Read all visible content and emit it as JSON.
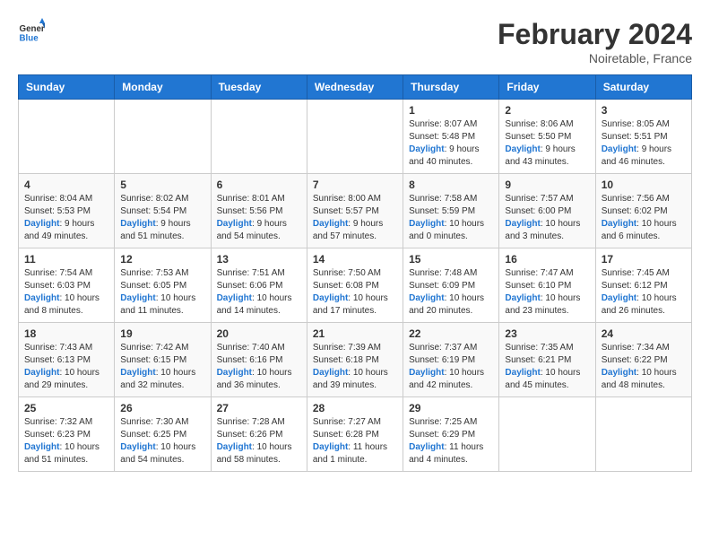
{
  "header": {
    "logo_general": "General",
    "logo_blue": "Blue",
    "month_year": "February 2024",
    "location": "Noiretable, France"
  },
  "weekdays": [
    "Sunday",
    "Monday",
    "Tuesday",
    "Wednesday",
    "Thursday",
    "Friday",
    "Saturday"
  ],
  "weeks": [
    [
      {
        "day": "",
        "sunrise": "",
        "sunset": "",
        "daylight": ""
      },
      {
        "day": "",
        "sunrise": "",
        "sunset": "",
        "daylight": ""
      },
      {
        "day": "",
        "sunrise": "",
        "sunset": "",
        "daylight": ""
      },
      {
        "day": "",
        "sunrise": "",
        "sunset": "",
        "daylight": ""
      },
      {
        "day": "1",
        "sunrise": "Sunrise: 8:07 AM",
        "sunset": "Sunset: 5:48 PM",
        "daylight": "Daylight: 9 hours and 40 minutes."
      },
      {
        "day": "2",
        "sunrise": "Sunrise: 8:06 AM",
        "sunset": "Sunset: 5:50 PM",
        "daylight": "Daylight: 9 hours and 43 minutes."
      },
      {
        "day": "3",
        "sunrise": "Sunrise: 8:05 AM",
        "sunset": "Sunset: 5:51 PM",
        "daylight": "Daylight: 9 hours and 46 minutes."
      }
    ],
    [
      {
        "day": "4",
        "sunrise": "Sunrise: 8:04 AM",
        "sunset": "Sunset: 5:53 PM",
        "daylight": "Daylight: 9 hours and 49 minutes."
      },
      {
        "day": "5",
        "sunrise": "Sunrise: 8:02 AM",
        "sunset": "Sunset: 5:54 PM",
        "daylight": "Daylight: 9 hours and 51 minutes."
      },
      {
        "day": "6",
        "sunrise": "Sunrise: 8:01 AM",
        "sunset": "Sunset: 5:56 PM",
        "daylight": "Daylight: 9 hours and 54 minutes."
      },
      {
        "day": "7",
        "sunrise": "Sunrise: 8:00 AM",
        "sunset": "Sunset: 5:57 PM",
        "daylight": "Daylight: 9 hours and 57 minutes."
      },
      {
        "day": "8",
        "sunrise": "Sunrise: 7:58 AM",
        "sunset": "Sunset: 5:59 PM",
        "daylight": "Daylight: 10 hours and 0 minutes."
      },
      {
        "day": "9",
        "sunrise": "Sunrise: 7:57 AM",
        "sunset": "Sunset: 6:00 PM",
        "daylight": "Daylight: 10 hours and 3 minutes."
      },
      {
        "day": "10",
        "sunrise": "Sunrise: 7:56 AM",
        "sunset": "Sunset: 6:02 PM",
        "daylight": "Daylight: 10 hours and 6 minutes."
      }
    ],
    [
      {
        "day": "11",
        "sunrise": "Sunrise: 7:54 AM",
        "sunset": "Sunset: 6:03 PM",
        "daylight": "Daylight: 10 hours and 8 minutes."
      },
      {
        "day": "12",
        "sunrise": "Sunrise: 7:53 AM",
        "sunset": "Sunset: 6:05 PM",
        "daylight": "Daylight: 10 hours and 11 minutes."
      },
      {
        "day": "13",
        "sunrise": "Sunrise: 7:51 AM",
        "sunset": "Sunset: 6:06 PM",
        "daylight": "Daylight: 10 hours and 14 minutes."
      },
      {
        "day": "14",
        "sunrise": "Sunrise: 7:50 AM",
        "sunset": "Sunset: 6:08 PM",
        "daylight": "Daylight: 10 hours and 17 minutes."
      },
      {
        "day": "15",
        "sunrise": "Sunrise: 7:48 AM",
        "sunset": "Sunset: 6:09 PM",
        "daylight": "Daylight: 10 hours and 20 minutes."
      },
      {
        "day": "16",
        "sunrise": "Sunrise: 7:47 AM",
        "sunset": "Sunset: 6:10 PM",
        "daylight": "Daylight: 10 hours and 23 minutes."
      },
      {
        "day": "17",
        "sunrise": "Sunrise: 7:45 AM",
        "sunset": "Sunset: 6:12 PM",
        "daylight": "Daylight: 10 hours and 26 minutes."
      }
    ],
    [
      {
        "day": "18",
        "sunrise": "Sunrise: 7:43 AM",
        "sunset": "Sunset: 6:13 PM",
        "daylight": "Daylight: 10 hours and 29 minutes."
      },
      {
        "day": "19",
        "sunrise": "Sunrise: 7:42 AM",
        "sunset": "Sunset: 6:15 PM",
        "daylight": "Daylight: 10 hours and 32 minutes."
      },
      {
        "day": "20",
        "sunrise": "Sunrise: 7:40 AM",
        "sunset": "Sunset: 6:16 PM",
        "daylight": "Daylight: 10 hours and 36 minutes."
      },
      {
        "day": "21",
        "sunrise": "Sunrise: 7:39 AM",
        "sunset": "Sunset: 6:18 PM",
        "daylight": "Daylight: 10 hours and 39 minutes."
      },
      {
        "day": "22",
        "sunrise": "Sunrise: 7:37 AM",
        "sunset": "Sunset: 6:19 PM",
        "daylight": "Daylight: 10 hours and 42 minutes."
      },
      {
        "day": "23",
        "sunrise": "Sunrise: 7:35 AM",
        "sunset": "Sunset: 6:21 PM",
        "daylight": "Daylight: 10 hours and 45 minutes."
      },
      {
        "day": "24",
        "sunrise": "Sunrise: 7:34 AM",
        "sunset": "Sunset: 6:22 PM",
        "daylight": "Daylight: 10 hours and 48 minutes."
      }
    ],
    [
      {
        "day": "25",
        "sunrise": "Sunrise: 7:32 AM",
        "sunset": "Sunset: 6:23 PM",
        "daylight": "Daylight: 10 hours and 51 minutes."
      },
      {
        "day": "26",
        "sunrise": "Sunrise: 7:30 AM",
        "sunset": "Sunset: 6:25 PM",
        "daylight": "Daylight: 10 hours and 54 minutes."
      },
      {
        "day": "27",
        "sunrise": "Sunrise: 7:28 AM",
        "sunset": "Sunset: 6:26 PM",
        "daylight": "Daylight: 10 hours and 58 minutes."
      },
      {
        "day": "28",
        "sunrise": "Sunrise: 7:27 AM",
        "sunset": "Sunset: 6:28 PM",
        "daylight": "Daylight: 11 hours and 1 minute."
      },
      {
        "day": "29",
        "sunrise": "Sunrise: 7:25 AM",
        "sunset": "Sunset: 6:29 PM",
        "daylight": "Daylight: 11 hours and 4 minutes."
      },
      {
        "day": "",
        "sunrise": "",
        "sunset": "",
        "daylight": ""
      },
      {
        "day": "",
        "sunrise": "",
        "sunset": "",
        "daylight": ""
      }
    ]
  ]
}
